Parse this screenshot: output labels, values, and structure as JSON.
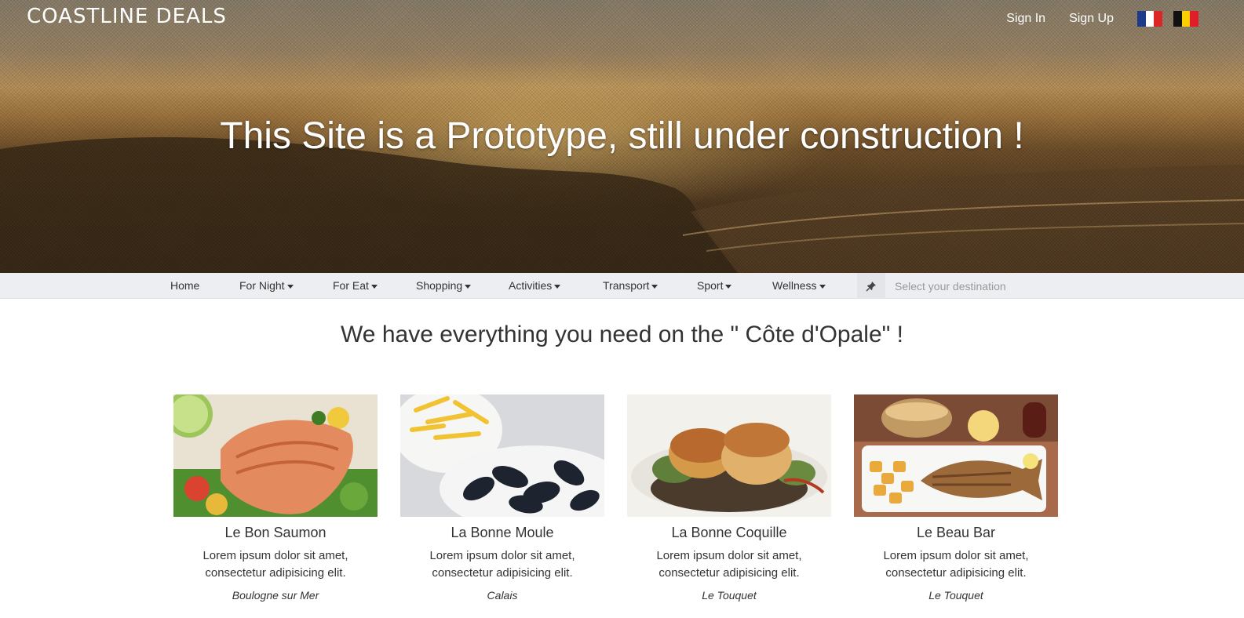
{
  "brand": {
    "logo_text": "COASTLINE DEALS"
  },
  "topnav": {
    "sign_in": "Sign In",
    "sign_up": "Sign Up",
    "flags": [
      {
        "name": "france-flag-icon",
        "colors": [
          "#1e3a8a",
          "#ffffff",
          "#dc2626"
        ]
      },
      {
        "name": "belgium-flag-icon",
        "colors": [
          "#111111",
          "#fbd000",
          "#e11d2a"
        ]
      }
    ]
  },
  "hero": {
    "title": "This Site is a Prototype, still under construction !"
  },
  "categories": [
    {
      "label": "Home",
      "dropdown": false
    },
    {
      "label": "For Night",
      "dropdown": true
    },
    {
      "label": "For Eat",
      "dropdown": true
    },
    {
      "label": "Shopping",
      "dropdown": true
    },
    {
      "label": "Activities",
      "dropdown": true
    },
    {
      "label": "Transport",
      "dropdown": true
    },
    {
      "label": "Sport",
      "dropdown": true
    },
    {
      "label": "Wellness",
      "dropdown": true
    }
  ],
  "search": {
    "placeholder": "Select your destination",
    "icon": "pin-icon"
  },
  "main": {
    "headline": "We have everything you need on the \" Côte d'Opale\" !"
  },
  "cards": [
    {
      "name": "Le Bon Saumon",
      "desc": "Lorem ipsum dolor sit amet, consectetur adipisicing elit.",
      "city": "Boulogne sur Mer",
      "image": "salmon-dish"
    },
    {
      "name": "La Bonne Moule",
      "desc": "Lorem ipsum dolor sit amet, consectetur adipisicing elit.",
      "city": "Calais",
      "image": "mussels-and-fries"
    },
    {
      "name": "La Bonne Coquille",
      "desc": "Lorem ipsum dolor sit amet, consectetur adipisicing elit.",
      "city": "Le Touquet",
      "image": "scallops-dish"
    },
    {
      "name": "Le Beau Bar",
      "desc": "Lorem ipsum dolor sit amet, consectetur adipisicing elit.",
      "city": "Le Touquet",
      "image": "grilled-fish-dish"
    }
  ]
}
